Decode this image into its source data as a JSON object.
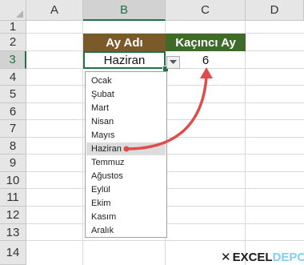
{
  "columns": [
    "A",
    "B",
    "C",
    "D"
  ],
  "rows": [
    "1",
    "2",
    "3",
    "4",
    "5",
    "6",
    "7",
    "8",
    "9",
    "10",
    "11",
    "12",
    "13",
    "14"
  ],
  "selected_column": "B",
  "selected_row": "3",
  "headers": {
    "ay_adi": {
      "label": "Ay Adı",
      "color": "#7a5a2b"
    },
    "kacinci_ay": {
      "label": "Kaçıncı Ay",
      "color": "#3e6a2a"
    }
  },
  "cells": {
    "b3": "Haziran",
    "c3": "6"
  },
  "dropdown": {
    "highlighted": "Haziran",
    "items": [
      "Ocak",
      "Şubat",
      "Mart",
      "Nisan",
      "Mayıs",
      "Haziran",
      "Temmuz",
      "Ağustos",
      "Eylül",
      "Ekim",
      "Kasım",
      "Aralık"
    ]
  },
  "accent_color": "#217346",
  "arrow_color": "#e04b4b",
  "logo": {
    "part1": "EXCEL",
    "part2": "DEPO"
  }
}
